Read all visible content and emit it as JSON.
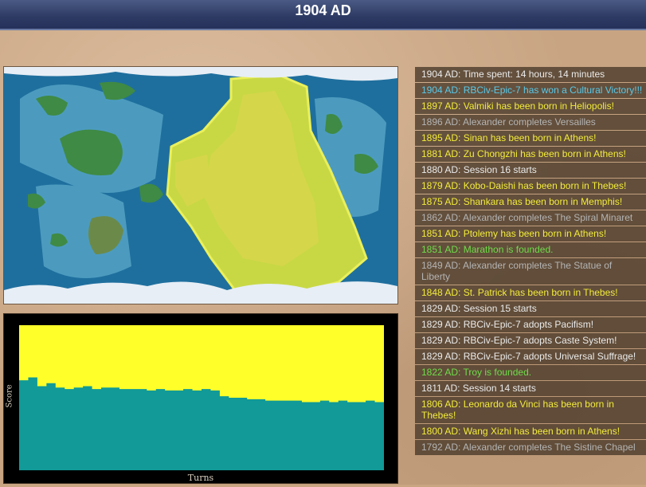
{
  "title": "1904 AD",
  "graph": {
    "ylabel": "Score",
    "xlabel": "Turns"
  },
  "colors": {
    "player_yellow": "#ffff2a",
    "rival_teal": "#119a97",
    "ocean": "#1f6f9e",
    "shallow": "#4c9bbf",
    "land": "#3f8a44",
    "ice": "#e7eef5"
  },
  "chart_data": {
    "type": "area",
    "title": "",
    "xlabel": "Turns",
    "ylabel": "Score",
    "grid": false,
    "series": [
      {
        "color": "#ffff2a",
        "values": [
          100,
          100,
          100,
          100,
          100,
          100,
          100,
          100,
          100,
          100,
          100,
          100,
          100,
          100,
          100,
          100,
          100,
          100,
          100,
          100,
          100,
          100,
          100,
          100,
          100,
          100,
          100,
          100,
          100,
          100,
          100,
          100,
          100,
          100,
          100,
          100,
          100,
          100,
          100,
          100,
          100
        ]
      },
      {
        "color": "#119a97",
        "values": [
          62,
          64,
          58,
          60,
          57,
          56,
          57,
          58,
          56,
          57,
          57,
          56,
          56,
          56,
          55,
          56,
          55,
          55,
          56,
          55,
          56,
          55,
          51,
          50,
          50,
          49,
          49,
          48,
          48,
          48,
          48,
          47,
          47,
          48,
          47,
          48,
          47,
          47,
          48,
          47,
          48
        ]
      }
    ]
  },
  "log": [
    {
      "text": "1904 AD: Time spent: 14 hours, 14 minutes",
      "color": "white"
    },
    {
      "text": "1904 AD: RBCiv-Epic-7 has won a Cultural Victory!!!",
      "color": "cyan"
    },
    {
      "text": "1897 AD: Valmiki has been born in Heliopolis!",
      "color": "yellow"
    },
    {
      "text": "1896 AD: Alexander completes Versailles",
      "color": "gray"
    },
    {
      "text": "1895 AD: Sinan has been born in Athens!",
      "color": "yellow"
    },
    {
      "text": "1881 AD: Zu Chongzhi has been born in Athens!",
      "color": "yellow"
    },
    {
      "text": "1880 AD: Session 16 starts",
      "color": "white"
    },
    {
      "text": "1879 AD: Kobo-Daishi has been born in Thebes!",
      "color": "yellow"
    },
    {
      "text": "1875 AD: Shankara has been born in Memphis!",
      "color": "yellow"
    },
    {
      "text": "1862 AD: Alexander completes The Spiral Minaret",
      "color": "gray"
    },
    {
      "text": "1851 AD: Ptolemy has been born in Athens!",
      "color": "yellow"
    },
    {
      "text": "1851 AD: Marathon is founded.",
      "color": "green"
    },
    {
      "text": "1849 AD: Alexander completes The Statue of Liberty",
      "color": "gray"
    },
    {
      "text": "1848 AD: St. Patrick has been born in Thebes!",
      "color": "yellow"
    },
    {
      "text": "1829 AD: Session 15 starts",
      "color": "white"
    },
    {
      "text": "1829 AD: RBCiv-Epic-7 adopts Pacifism!",
      "color": "white"
    },
    {
      "text": "1829 AD: RBCiv-Epic-7 adopts Caste System!",
      "color": "white"
    },
    {
      "text": "1829 AD: RBCiv-Epic-7 adopts Universal Suffrage!",
      "color": "white"
    },
    {
      "text": "1822 AD: Troy is founded.",
      "color": "green"
    },
    {
      "text": "1811 AD: Session 14 starts",
      "color": "white"
    },
    {
      "text": "1806 AD: Leonardo da Vinci has been born in Thebes!",
      "color": "yellow"
    },
    {
      "text": "1800 AD: Wang Xizhi has been born in Athens!",
      "color": "yellow"
    },
    {
      "text": "1792 AD: Alexander completes The Sistine Chapel",
      "color": "gray"
    }
  ]
}
